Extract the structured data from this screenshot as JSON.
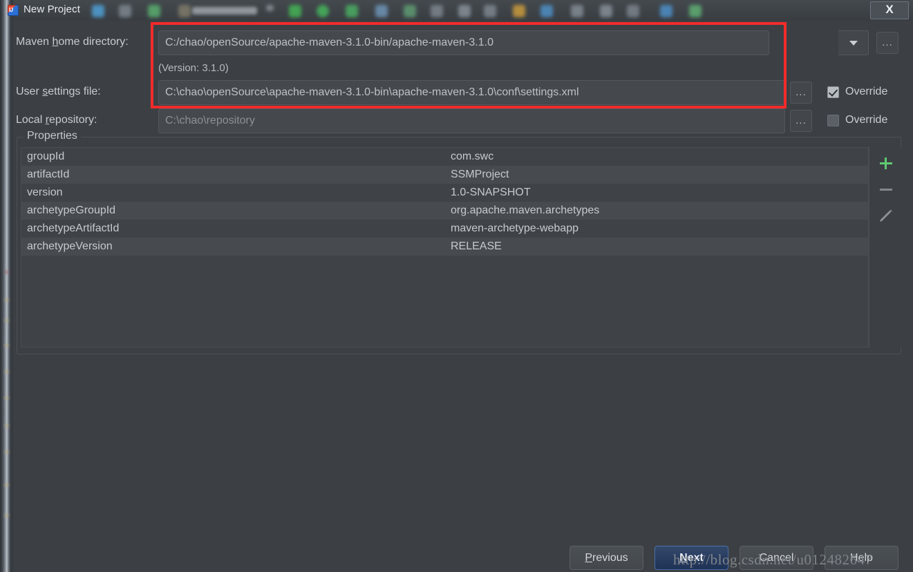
{
  "window": {
    "title": "New Project",
    "app_icon": "intellij-idea-icon",
    "close_label": "X"
  },
  "background_toolbar": {
    "project_name_blurred": "TestMybatis"
  },
  "form": {
    "maven_home": {
      "label_prefix": "Maven ",
      "label_mnemonic": "h",
      "label_suffix": "ome directory:",
      "value": "C:/chao/openSource/apache-maven-3.1.0-bin/apache-maven-3.1.0",
      "dropdown_icon": "chevron-down-icon",
      "browse_label": "...",
      "version_note": "(Version: 3.1.0)"
    },
    "user_settings": {
      "label_prefix": "User ",
      "label_mnemonic": "s",
      "label_suffix": "ettings file:",
      "value": "C:\\chao\\openSource\\apache-maven-3.1.0-bin\\apache-maven-3.1.0\\conf\\settings.xml",
      "browse_label": "...",
      "override_label": "Override",
      "override_checked": true
    },
    "local_repository": {
      "label_prefix": "Local ",
      "label_mnemonic": "r",
      "label_suffix": "epository:",
      "value": "C:\\chao\\repository",
      "browse_label": "...",
      "override_label": "Override",
      "override_checked": false
    }
  },
  "properties": {
    "group_title": "Properties",
    "rows": [
      {
        "key": "groupId",
        "value": "com.swc"
      },
      {
        "key": "artifactId",
        "value": "SSMProject"
      },
      {
        "key": "version",
        "value": "1.0-SNAPSHOT"
      },
      {
        "key": "archetypeGroupId",
        "value": "org.apache.maven.archetypes"
      },
      {
        "key": "archetypeArtifactId",
        "value": "maven-archetype-webapp"
      },
      {
        "key": "archetypeVersion",
        "value": "RELEASE"
      }
    ],
    "actions": [
      {
        "name": "add-property-button",
        "icon": "plus-icon",
        "color": "#5fcb72"
      },
      {
        "name": "remove-property-button",
        "icon": "minus-icon",
        "color": "#83888d"
      },
      {
        "name": "edit-property-button",
        "icon": "pencil-icon",
        "color": "#8d9399"
      }
    ]
  },
  "footer": {
    "previous": {
      "prefix": "",
      "mnemonic": "P",
      "suffix": "revious"
    },
    "next": {
      "prefix": "",
      "mnemonic": "N",
      "suffix": "ext",
      "is_default": true
    },
    "cancel": "Cancel",
    "help": "Help"
  },
  "annotation": {
    "highlight_color": "#f32b2b"
  },
  "watermark": {
    "text": "http://blog.csdn.net/u012482647"
  }
}
